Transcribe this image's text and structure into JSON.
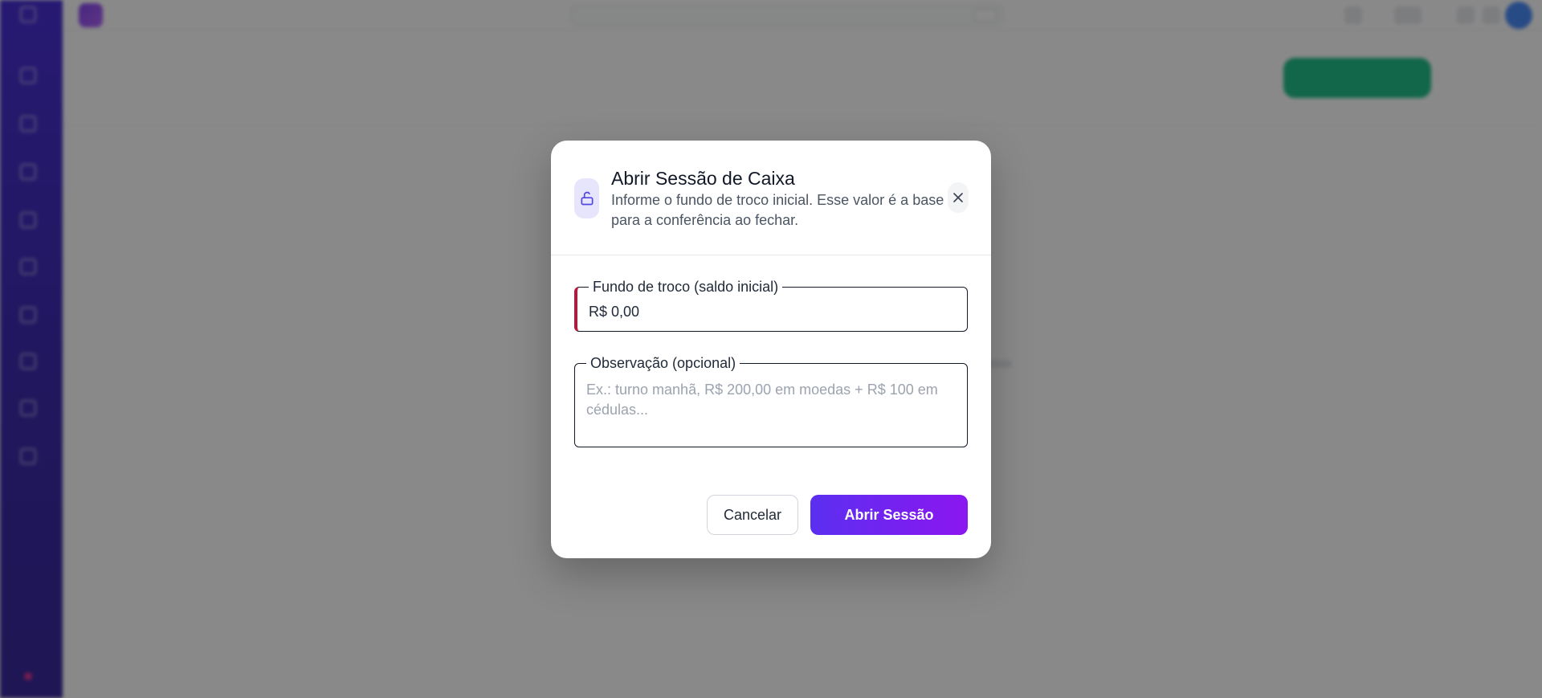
{
  "background": {
    "app_name": "",
    "search_placeholder": "",
    "page_title": "",
    "tabs": [],
    "primary_action": ""
  },
  "modal": {
    "title": "Abrir Sessão de Caixa",
    "subtitle": "Informe o fundo de troco inicial. Esse valor é a base para a conferência ao fechar.",
    "header_icon": "lock-open-icon",
    "close_icon": "close-icon",
    "amount_field": {
      "label": "Fundo de troco (saldo inicial)",
      "value": "R$ 0,00"
    },
    "note_field": {
      "label": "Observação (opcional)",
      "placeholder": "Ex.: turno manhã, R$ 200,00 em moedas + R$ 100 em cédulas...",
      "value": ""
    },
    "cancel_label": "Cancelar",
    "submit_label": "Abrir Sessão"
  },
  "colors": {
    "accent_start": "#5b2ff0",
    "accent_end": "#8b16f0",
    "error_indicator": "#b8163a",
    "sidebar": "#2c1aa8"
  }
}
